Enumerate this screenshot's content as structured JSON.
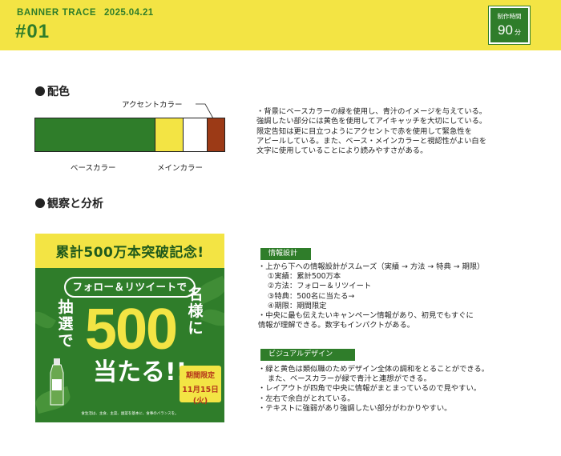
{
  "header": {
    "title": "BANNER TRACE",
    "date": "2025.04.21",
    "number": "#01",
    "time_label": "制作時間",
    "time_value": "90",
    "time_unit": "分"
  },
  "colors_section": {
    "title": "配色",
    "accent_label": "アクセントカラー",
    "base_label": "ベースカラー",
    "main_label": "メインカラー",
    "swatches": {
      "base": "#2f7d2a",
      "main": "#f3e444",
      "white": "#ffffff",
      "accent": "#9c3a16"
    },
    "notes": [
      "・背景にベースカラーの緑を使用し、青汁のイメージを与えている。",
      "強調したい部分には黄色を使用してアイキャッチを大切にしている。",
      "限定告知は更に目立つようにアクセントで赤を使用して緊急性を",
      "アピールしている。また、ベース・メインカラーと視認性がよい白を",
      "文字に使用していることにより読みやすさがある。"
    ]
  },
  "analysis_section": {
    "title": "観察と分析"
  },
  "banner": {
    "top_text": "累計500万本突破記念!",
    "pill_text": "フォロー＆リツイートで",
    "left_text": "抽選で",
    "right_text": "名様に",
    "big_number": "500",
    "ataru": "当たる!!",
    "limit_title": "期間限定",
    "limit_date": "11月15日(火)",
    "footer": "食生活は、主食、主菜、副菜を基本に、食事のバランスを。"
  },
  "info_design": {
    "tag": "情報設計",
    "lines": [
      "・上から下への情報設計がスムーズ（実績 → 方法 → 特典 → 期限）",
      "①実績：累計500万本",
      "②方法：フォロー＆リツイート",
      "③特典：500名に当たる→",
      "④期限：期間限定",
      "・中央に最も伝えたいキャンペーン情報があり、初見でもすぐに",
      "情報が理解できる。数字もインパクトがある。"
    ]
  },
  "visual_design": {
    "tag": "ビジュアルデザイン",
    "lines": [
      "・緑と黄色は類似職のためデザイン全体の調和をとることができる。",
      "また、ベースカラーが緑で青汁と連想ができる。",
      "・レイアウトが四角で中央に情報がまとまっているので見やすい。",
      "・左右で余白がとれている。",
      "・テキストに強弱があり強調したい部分がわかりやすい。"
    ]
  }
}
